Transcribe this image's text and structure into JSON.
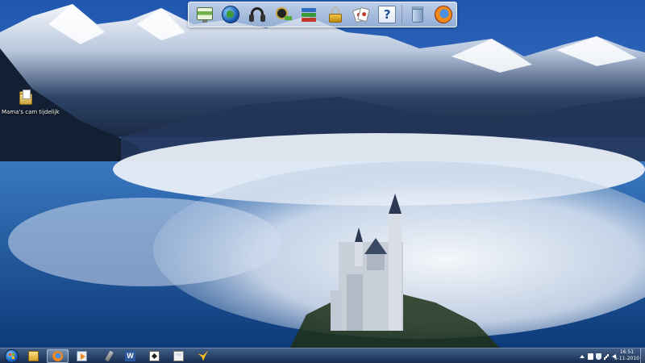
{
  "desktop": {
    "icons": [
      {
        "label": "Mama's cam tijdelijk",
        "icon": "folder-icon"
      }
    ]
  },
  "dock": {
    "items": [
      {
        "name": "monitor",
        "icon": "monitor-icon"
      },
      {
        "name": "internet",
        "icon": "globe-icon"
      },
      {
        "name": "music",
        "icon": "headphones-icon"
      },
      {
        "name": "video",
        "icon": "film-reel-icon"
      },
      {
        "name": "library",
        "icon": "books-icon"
      },
      {
        "name": "security",
        "icon": "padlock-icon"
      },
      {
        "name": "games",
        "icon": "playing-cards-icon"
      },
      {
        "name": "help",
        "icon": "help-icon",
        "glyph": "?"
      },
      {
        "name": "recycle-bin",
        "icon": "recycle-bin-icon"
      },
      {
        "name": "firefox",
        "icon": "firefox-icon"
      }
    ]
  },
  "taskbar": {
    "start": {
      "icon": "windows-orb-icon"
    },
    "pinned": [
      {
        "icon": "explorer-folder-icon"
      },
      {
        "icon": "firefox-icon",
        "active": true
      },
      {
        "icon": "media-player-icon"
      },
      {
        "icon": "tool-icon"
      },
      {
        "icon": "word-icon",
        "glyph": "W"
      },
      {
        "icon": "solitaire-icon"
      },
      {
        "icon": "calculator-icon"
      },
      {
        "icon": "bird-app-icon"
      }
    ],
    "tray": [
      "show-hidden-icons-icon",
      "action-center-flag-icon",
      "security-shield-icon",
      "network-icon",
      "volume-icon"
    ],
    "clock": {
      "time": "16:51",
      "date": "5-11-2010"
    }
  },
  "colors": {
    "sky": "#2f6fc2",
    "fog": "#e9eef6",
    "taskbar": "#22406e"
  }
}
